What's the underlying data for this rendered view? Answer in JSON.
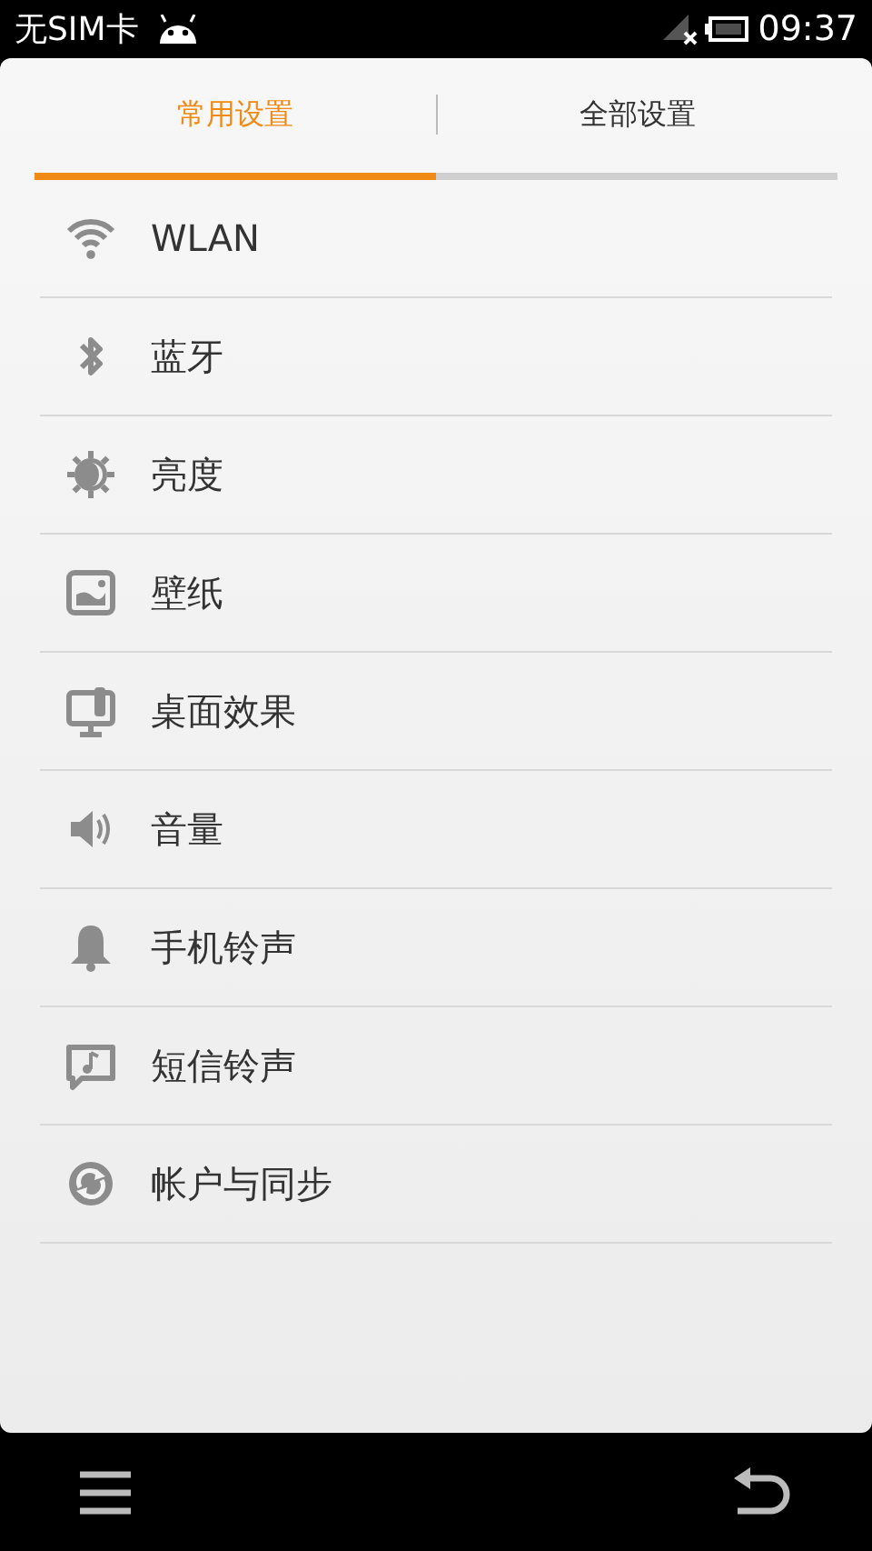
{
  "status_bar": {
    "carrier": "无SIM卡",
    "time": "09:37"
  },
  "tabs": [
    {
      "label": "常用设置",
      "selected": true
    },
    {
      "label": "全部设置",
      "selected": false
    }
  ],
  "settings": [
    {
      "label": "WLAN"
    },
    {
      "label": "蓝牙"
    },
    {
      "label": "亮度"
    },
    {
      "label": "壁纸"
    },
    {
      "label": "桌面效果"
    },
    {
      "label": "音量"
    },
    {
      "label": "手机铃声"
    },
    {
      "label": "短信铃声"
    },
    {
      "label": "帐户与同步"
    }
  ]
}
